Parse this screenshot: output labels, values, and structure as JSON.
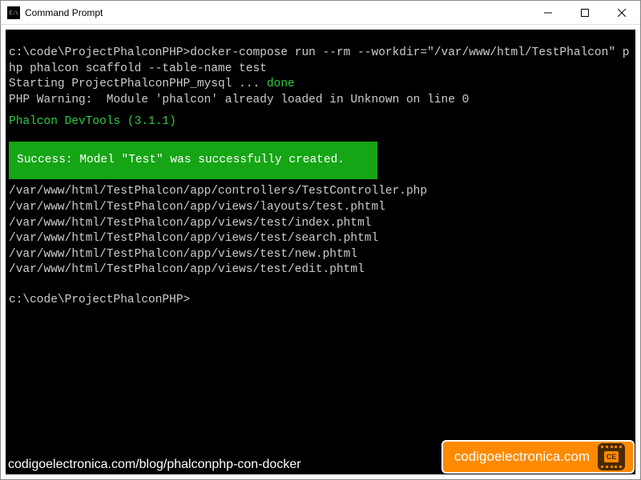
{
  "window": {
    "title": "Command Prompt"
  },
  "terminal": {
    "prompt1_path": "c:\\code\\ProjectPhalconPHP>",
    "command": "docker-compose run --rm --workdir=\"/var/www/html/TestPhalcon\" php phalcon scaffold --table-name test",
    "starting_prefix": "Starting ProjectPhalconPHP_mysql ... ",
    "starting_status": "done",
    "warning": "PHP Warning:  Module 'phalcon' already loaded in Unknown on line 0",
    "devtools": "Phalcon DevTools (3.1.1)",
    "success": "  Success: Model \"Test\" was successfully created.",
    "files": [
      "/var/www/html/TestPhalcon/app/controllers/TestController.php",
      "/var/www/html/TestPhalcon/app/views/layouts/test.phtml",
      "/var/www/html/TestPhalcon/app/views/test/index.phtml",
      "/var/www/html/TestPhalcon/app/views/test/search.phtml",
      "/var/www/html/TestPhalcon/app/views/test/new.phtml",
      "/var/www/html/TestPhalcon/app/views/test/edit.phtml"
    ],
    "prompt2": "c:\\code\\ProjectPhalconPHP>"
  },
  "watermark": {
    "url": "codigoelectronica.com/blog/phalconphp-con-docker",
    "site": "codigoelectronica.com",
    "chip_text": "CE"
  }
}
